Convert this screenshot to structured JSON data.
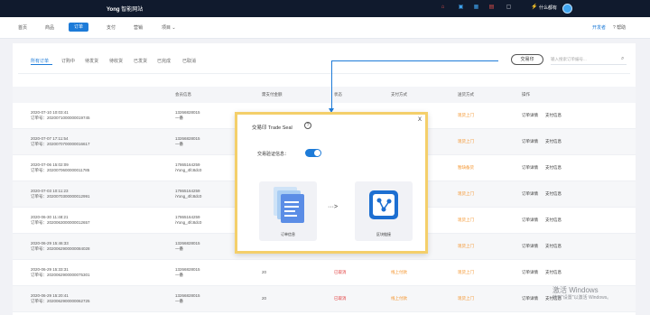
{
  "topbar": {
    "brand_mark": "Yong",
    "brand_name": "智能网站",
    "user_name": "什么都有"
  },
  "colors": {
    "accent": "#1d7bd8",
    "topbar": "#101a2d",
    "modal_border": "#f4cf6a",
    "status_red": "#e03a3a",
    "status_orange": "#f4932a"
  },
  "nav": {
    "items": [
      "首页",
      "商品",
      "订单",
      "支付",
      "营销",
      "项目"
    ],
    "active": "订单",
    "right_items": [
      "开发者",
      "帮助"
    ]
  },
  "tabs": {
    "items": [
      "所有订单",
      "订购中",
      "待发货",
      "待收货",
      "已发货",
      "已完成",
      "已取消"
    ],
    "active": "所有订单"
  },
  "toolbar": {
    "trade_seal_button": "交易印",
    "search_placeholder": "输入搜索订单编号..."
  },
  "table": {
    "headers": [
      "会员信息",
      "需支付金额",
      "状态",
      "支付方式",
      "送货方式",
      "操作"
    ],
    "rows": [
      {
        "time": "2020-07-10 10:03:41",
        "order_no": "订单号：2020071000000019745",
        "member_1": "13266828015",
        "member_2": "一番",
        "amount": "",
        "status": "",
        "pay": "",
        "deliver": "现货上门",
        "op1": "订单详情",
        "op2": "支付信息"
      },
      {
        "time": "2020-07-07 17:11:54",
        "order_no": "订单号：2020070700000016617",
        "member_1": "13266828015",
        "member_2": "一番",
        "amount": "",
        "status": "",
        "pay": "",
        "deliver": "现货上门",
        "op1": "订单详情",
        "op2": "支付信息"
      },
      {
        "time": "2020-07-06 15:02:09",
        "order_no": "订单号：2020070600000011785",
        "member_1": "17865164259",
        "member_2": "iYong_4fc8dc0",
        "amount": "",
        "status": "",
        "pay": "",
        "deliver": "暂缺备货",
        "op1": "订单详情",
        "op2": "支付信息"
      },
      {
        "time": "2020-07-03 10:11:23",
        "order_no": "订单号：2020070300000012991",
        "member_1": "17865164259",
        "member_2": "iYong_4fc8dc0",
        "amount": "",
        "status": "",
        "pay": "",
        "deliver": "现货上门",
        "op1": "订单详情",
        "op2": "支付信息"
      },
      {
        "time": "2020-06-30 11:48:21",
        "order_no": "订单号：2020063000000012657",
        "member_1": "17865164259",
        "member_2": "iYong_4fc8dc0",
        "amount": "",
        "status": "",
        "pay": "",
        "deliver": "现货上门",
        "op1": "订单详情",
        "op2": "支付信息"
      },
      {
        "time": "2020-06-29 15:46:33",
        "order_no": "订单号：2020062900000084028",
        "member_1": "13266828015",
        "member_2": "一番",
        "amount": "",
        "status": "",
        "pay": "",
        "deliver": "现货上门",
        "op1": "订单详情",
        "op2": "支付信息"
      },
      {
        "time": "2020-06-29 15:33:31",
        "order_no": "订单号：2020062900000075301",
        "member_1": "13266828015",
        "member_2": "一番",
        "amount": "20",
        "status": "已取消",
        "pay": "线上付款",
        "deliver": "现货上门",
        "op1": "订单详情",
        "op2": "支付信息"
      },
      {
        "time": "2020-06-29 15:20:41",
        "order_no": "订单号：2020062900000062725",
        "member_1": "13266828015",
        "member_2": "一番",
        "amount": "20",
        "status": "已取消",
        "pay": "线上付款",
        "deliver": "现货上门",
        "op1": "订单详情",
        "op2": "支付信息"
      }
    ]
  },
  "modal": {
    "title": "交易印 Trade Seal",
    "help": "?",
    "close": "X",
    "verify_label": "交易验证信息：",
    "verify_enabled": true,
    "card_left_label": "订单信息",
    "card_right_label": "区块链接",
    "flow_arrow": "···>"
  },
  "watermark": {
    "line1": "激活 Windows",
    "line2": "转到\"设置\"以激活 Windows。"
  }
}
